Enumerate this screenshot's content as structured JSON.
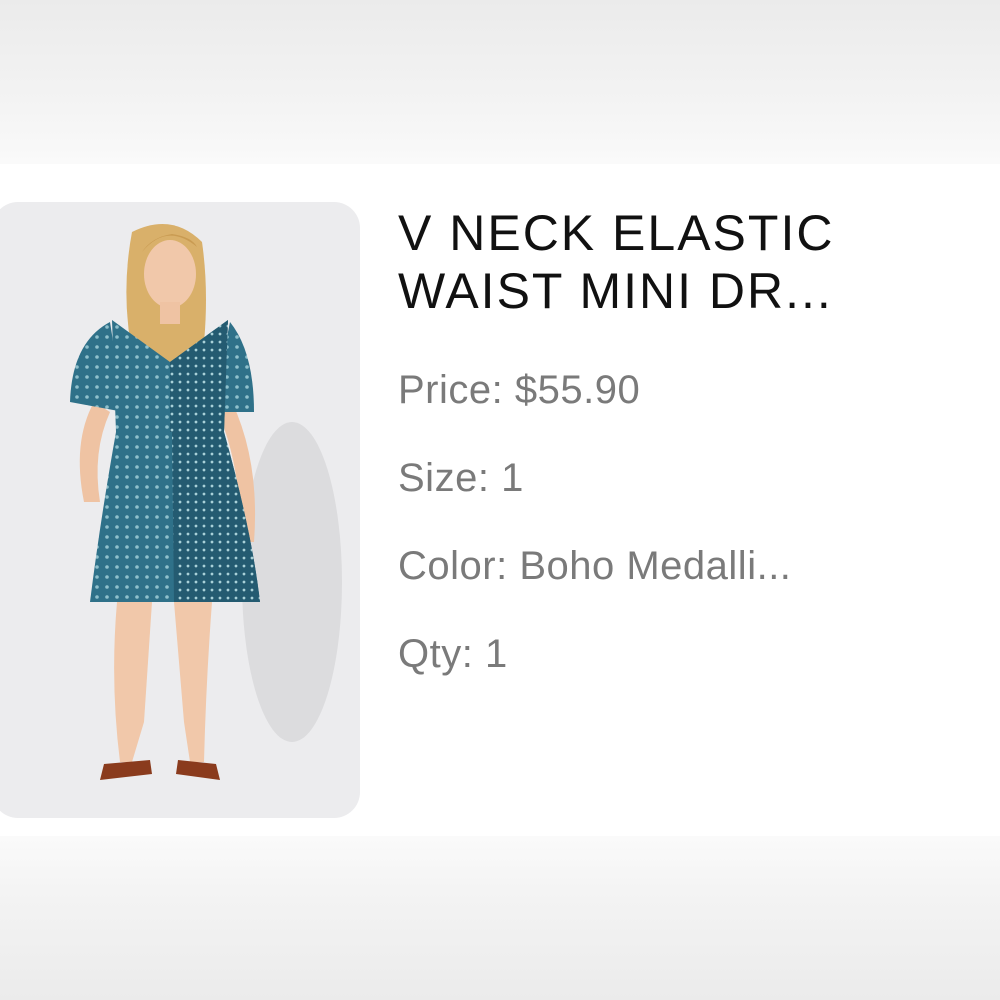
{
  "product": {
    "image_alt": "Model wearing blue patterned mini dress",
    "title_line_1": "V NECK ELASTIC",
    "title_line_2": "WAIST MINI DR...",
    "price_label": "Price:",
    "price_value": "$55.90",
    "size_label": "Size:",
    "size_value": "1",
    "color_label": "Color:",
    "color_value": "Boho Medalli...",
    "qty_label": "Qty:",
    "qty_value": "1"
  },
  "colors": {
    "image_bg": "#ececee",
    "dress": "#2f7189",
    "dress_dark": "#245b71",
    "text_primary": "#111111",
    "text_secondary": "#7a7a7a"
  }
}
